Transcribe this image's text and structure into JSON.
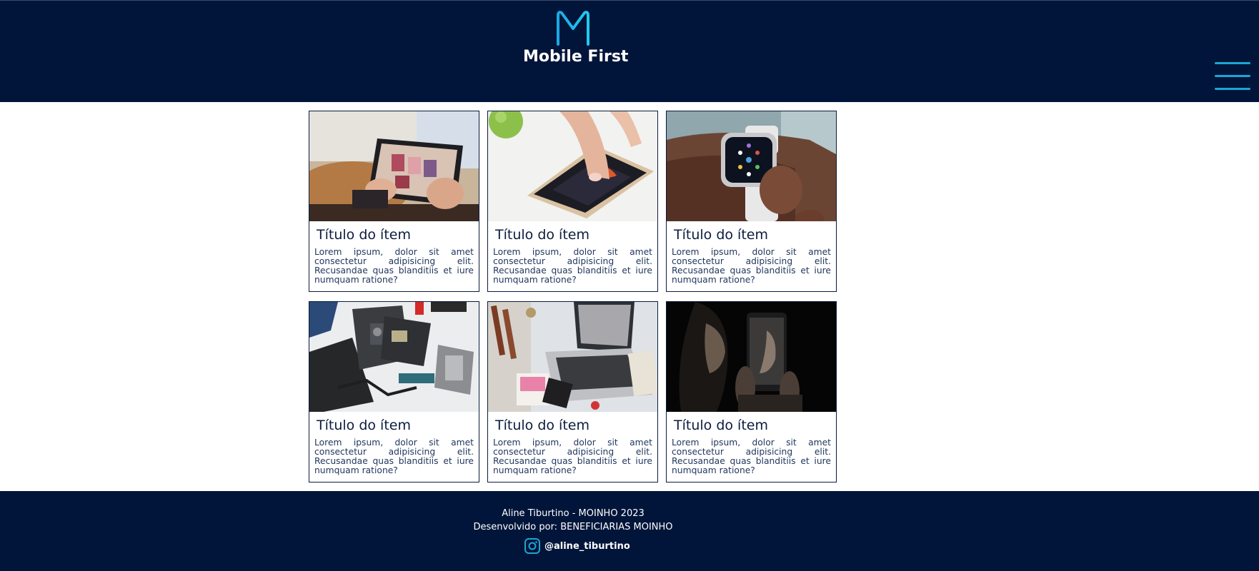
{
  "header": {
    "brand": "Mobile First",
    "menu_icon": "hamburger-menu-icon",
    "accent_color": "#1ca6d4",
    "background_color": "#01153a"
  },
  "cards": [
    {
      "image": "tablet-in-hands",
      "title": "Título do ítem",
      "text": "Lorem ipsum, dolor sit amet consectetur adipisicing elit. Recusandae quas blanditiis et iure numquam ratione?"
    },
    {
      "image": "smartphone-with-apple",
      "title": "Título do ítem",
      "text": "Lorem ipsum, dolor sit amet consectetur adipisicing elit. Recusandae quas blanditiis et iure numquam ratione?"
    },
    {
      "image": "smartwatch-on-wrist",
      "title": "Título do ítem",
      "text": "Lorem ipsum, dolor sit amet consectetur adipisicing elit. Recusandae quas blanditiis et iure numquam ratione?"
    },
    {
      "image": "disassembled-phone-parts",
      "title": "Título do ítem",
      "text": "Lorem ipsum, dolor sit amet consectetur adipisicing elit. Recusandae quas blanditiis et iure numquam ratione?"
    },
    {
      "image": "laptop-on-desk",
      "title": "Título do ítem",
      "text": "Lorem ipsum, dolor sit amet consectetur adipisicing elit. Recusandae quas blanditiis et iure numquam ratione?"
    },
    {
      "image": "woman-with-phone-reflection",
      "title": "Título do ítem",
      "text": "Lorem ipsum, dolor sit amet consectetur adipisicing elit. Recusandae quas blanditiis et iure numquam ratione?"
    }
  ],
  "footer": {
    "line1": "Aline Tiburtino - MOINHO 2023",
    "line2": "Desenvolvido por: BENEFICIARIAS MOINHO",
    "social_icon": "instagram-icon",
    "social_handle": "@aline_tiburtino"
  }
}
